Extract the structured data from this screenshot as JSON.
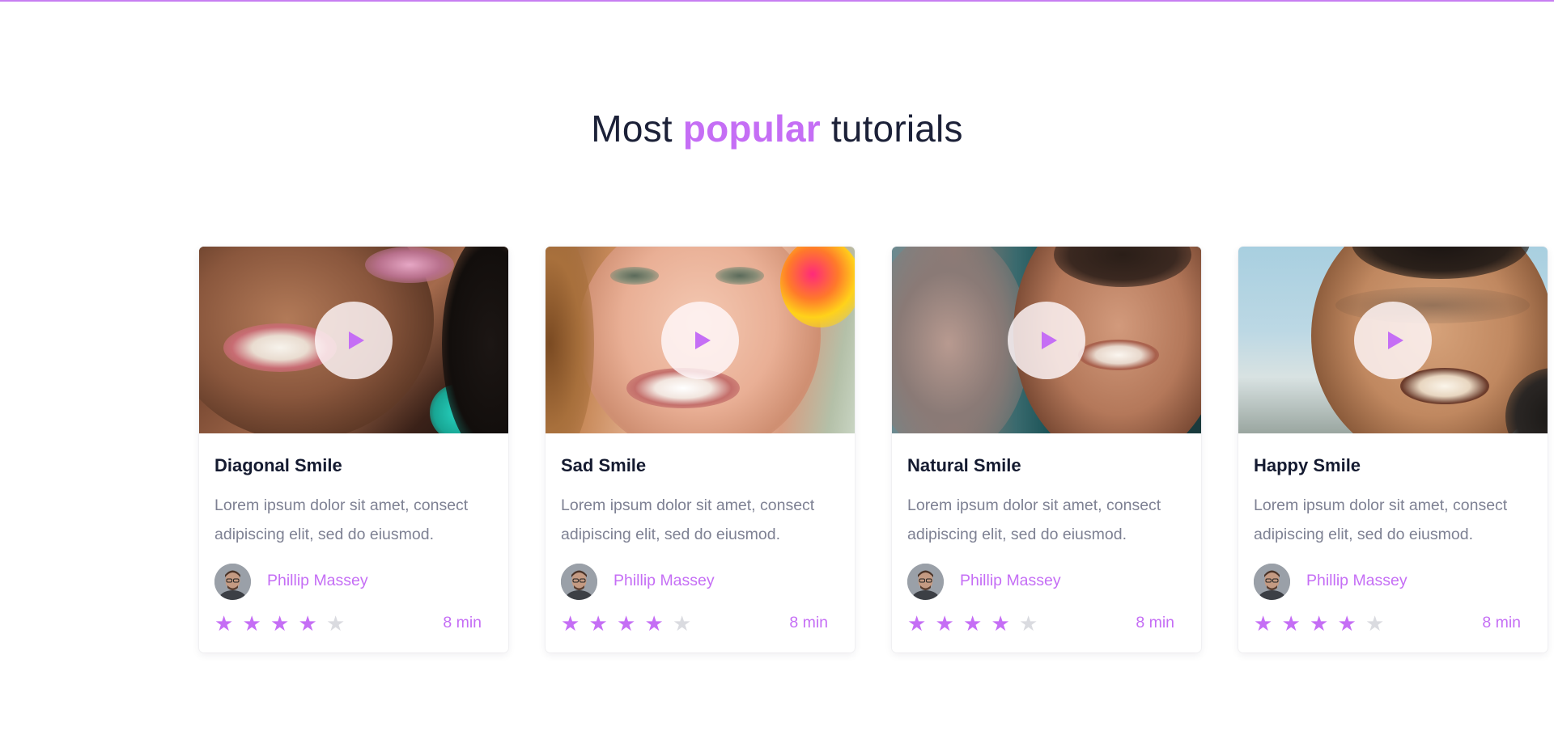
{
  "heading": {
    "prefix": "Most",
    "accent": "popular",
    "suffix": "tutorials"
  },
  "colors": {
    "accent": "#c56ef5",
    "title": "#141a30",
    "body": "#7e8193",
    "star_off": "#dadbe0"
  },
  "cards": [
    {
      "title": "Diagonal Smile",
      "description": "Lorem ipsum dolor sit amet, consect adipiscing elit, sed do eiusmod.",
      "author": "Phillip Massey",
      "rating": 4,
      "rating_max": 5,
      "duration": "8 min",
      "play_icon": "play-icon"
    },
    {
      "title": "Sad Smile",
      "description": "Lorem ipsum dolor sit amet, consect adipiscing elit, sed do eiusmod.",
      "author": "Phillip Massey",
      "rating": 4,
      "rating_max": 5,
      "duration": "8 min",
      "play_icon": "play-icon"
    },
    {
      "title": "Natural Smile",
      "description": "Lorem ipsum dolor sit amet, consect adipiscing elit, sed do eiusmod.",
      "author": "Phillip Massey",
      "rating": 4,
      "rating_max": 5,
      "duration": "8 min",
      "play_icon": "play-icon"
    },
    {
      "title": "Happy Smile",
      "description": "Lorem ipsum dolor sit amet, consect adipiscing elit, sed do eiusmod.",
      "author": "Phillip Massey",
      "rating": 4,
      "rating_max": 5,
      "duration": "8 min",
      "play_icon": "play-icon"
    }
  ]
}
